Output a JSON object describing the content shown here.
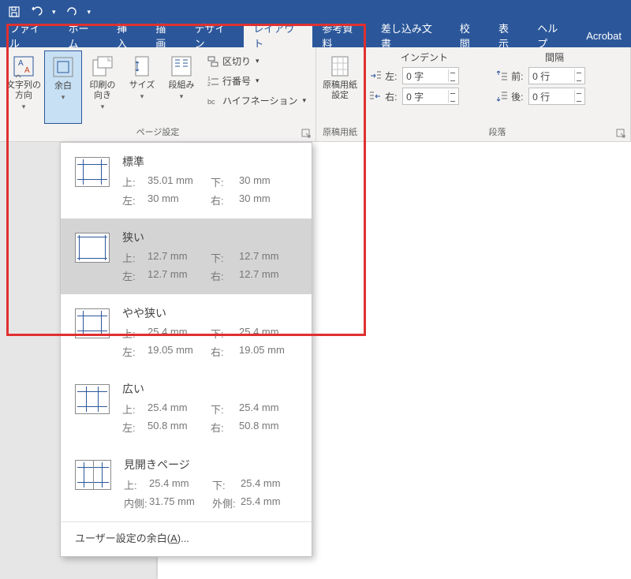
{
  "quick_access": {
    "save": "保存",
    "undo": "元に戻す",
    "redo": "やり直し"
  },
  "tabs": {
    "file": "ファイル",
    "home": "ホーム",
    "insert": "挿入",
    "draw": "描画",
    "design": "デザイン",
    "layout": "レイアウト",
    "references": "参考資料",
    "mailings": "差し込み文書",
    "review": "校閲",
    "view": "表示",
    "help": "ヘルプ",
    "acrobat": "Acrobat"
  },
  "ribbon": {
    "page_setup": {
      "text_direction": "文字列の\n方向",
      "margins": "余白",
      "orientation": "印刷の\n向き",
      "size": "サイズ",
      "columns": "段組み",
      "breaks": "区切り",
      "line_numbers": "行番号",
      "hyphenation": "ハイフネーション",
      "group_label": "ページ設定"
    },
    "manuscript": {
      "button": "原稿用紙\n設定",
      "group_label": "原稿用紙"
    },
    "paragraph": {
      "indent_header": "インデント",
      "spacing_header": "間隔",
      "left_label": "左:",
      "right_label": "右:",
      "before_label": "前:",
      "after_label": "後:",
      "left_val": "0 字",
      "right_val": "0 字",
      "before_val": "0 行",
      "after_val": "0 行",
      "group_label": "段落"
    }
  },
  "margin_menu": {
    "normal": {
      "title": "標準",
      "top_l": "上:",
      "top": "35.01 mm",
      "bottom_l": "下:",
      "bottom": "30 mm",
      "left_l": "左:",
      "left": "30 mm",
      "right_l": "右:",
      "right": "30 mm"
    },
    "narrow": {
      "title": "狭い",
      "top_l": "上:",
      "top": "12.7 mm",
      "bottom_l": "下:",
      "bottom": "12.7 mm",
      "left_l": "左:",
      "left": "12.7 mm",
      "right_l": "右:",
      "right": "12.7 mm"
    },
    "moderate": {
      "title": "やや狭い",
      "top_l": "上:",
      "top": "25.4 mm",
      "bottom_l": "下:",
      "bottom": "25.4 mm",
      "left_l": "左:",
      "left": "19.05 mm",
      "right_l": "右:",
      "right": "19.05 mm"
    },
    "wide": {
      "title": "広い",
      "top_l": "上:",
      "top": "25.4 mm",
      "bottom_l": "下:",
      "bottom": "25.4 mm",
      "left_l": "左:",
      "left": "50.8 mm",
      "right_l": "右:",
      "right": "50.8 mm"
    },
    "mirrored": {
      "title": "見開きページ",
      "top_l": "上:",
      "top": "25.4 mm",
      "bottom_l": "下:",
      "bottom": "25.4 mm",
      "in_l": "内側:",
      "in": "31.75 mm",
      "out_l": "外側:",
      "out": "25.4 mm"
    },
    "custom_pre": "ユーザー設定の余白(",
    "custom_key": "A",
    "custom_post": ")..."
  }
}
